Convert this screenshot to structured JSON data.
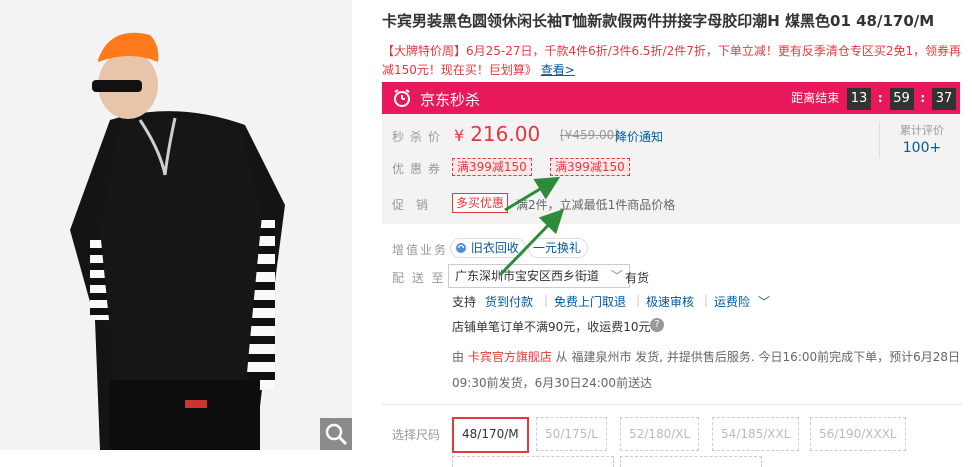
{
  "product": {
    "title": "卡宾男装黑色圆领休闲长袖T恤新款假两件拼接字母胶印潮H 煤黑色01 48/170/M",
    "promo_text": "【大牌特价周】6月25-27日，千款4件6折/3件6.5折/2件7折，下单立减！更有反季清仓专区买2免1，领券再减150元！现在买！巨划算》",
    "promo_more": "查看>"
  },
  "seckill": {
    "label": "京东秒杀",
    "countdown_label": "距离结束",
    "hours": "13",
    "minutes": "59",
    "seconds": "37"
  },
  "price": {
    "label": "秒杀价",
    "currency": "¥",
    "value": "216.00",
    "original": "[¥459.00]",
    "notify": "降价通知"
  },
  "reviews": {
    "label": "累计评价",
    "count": "100+"
  },
  "coupons": {
    "label": "优惠券",
    "items": [
      "满399减150",
      "满399减150"
    ]
  },
  "promotion": {
    "label": "促　销",
    "tag": "多买优惠",
    "desc": "满2件，立减最低1件商品价格"
  },
  "services": {
    "label": "增值业务",
    "items": [
      "旧衣回收",
      "一元换礼"
    ]
  },
  "delivery": {
    "label": "配 送 至",
    "address": "广东深圳市宝安区西乡街道",
    "stock": "有货",
    "support_lead": "支持",
    "support_items": [
      "货到付款",
      "免费上门取退",
      "极速审核",
      "运费险"
    ],
    "fee_text": "店铺单笔订单不满90元，收运费10元",
    "seller_prefix": "由 ",
    "shop_name": "卡宾官方旗舰店",
    "seller_text": " 从 福建泉州市 发货, 并提供售后服务. 今日16:00前完成下单，预计6月28日09:30前发货，6月30日24:00前送达"
  },
  "size": {
    "label": "选择尺码",
    "options": [
      "48/170/M",
      "50/175/L",
      "52/180/XL",
      "54/185/XXL",
      "56/190/XXXL"
    ],
    "selected": "48/170/M"
  },
  "colors": {
    "accent": "#e4393c",
    "seckill": "#e9185a",
    "link": "#005aa0",
    "arrow": "#2e8b3a"
  }
}
